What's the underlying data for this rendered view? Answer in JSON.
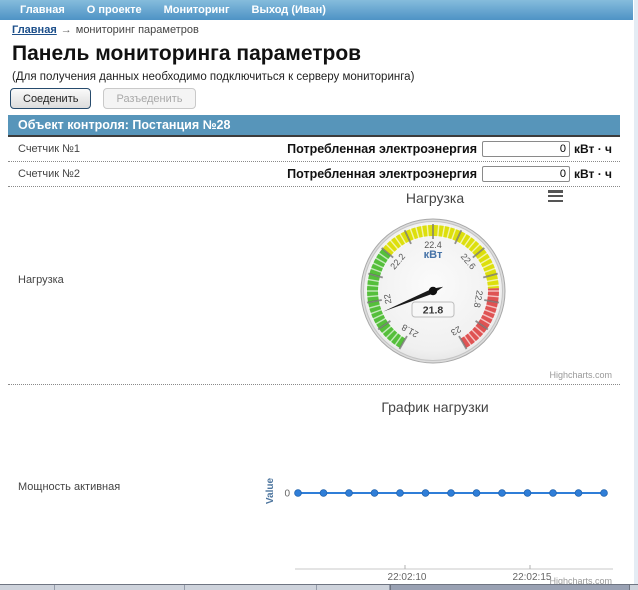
{
  "nav": {
    "items": [
      {
        "label": "Главная"
      },
      {
        "label": "О проекте"
      },
      {
        "label": "Мониторинг"
      },
      {
        "label": "Выход (Иван)"
      }
    ]
  },
  "breadcrumb": {
    "home": "Главная",
    "separator": "→",
    "current": "мониторинг параметров"
  },
  "page": {
    "title": "Панель мониторинга параметров",
    "subtitle": "(Для получения данных необходимо подключиться к серверу мониторинга)",
    "connect_label": "Соеденить",
    "disconnect_label": "Разъеденить"
  },
  "panel": {
    "header": "Объект контроля: Постанция №28",
    "counters": [
      {
        "label": "Счетчик №1",
        "field": "Потребленная электроэнергия",
        "value": "0",
        "unit": "кВт · ч"
      },
      {
        "label": "Счетчик №2",
        "field": "Потребленная электроэнергия",
        "value": "0",
        "unit": "кВт · ч"
      }
    ],
    "gauge_row_label": "Нагрузка",
    "line_row_label": "Мощность активная"
  },
  "colors": {
    "nav_top": "#85bcdc",
    "nav_bottom": "#4e93c5",
    "panel_header": "#5795ba",
    "band_green": "#55BF3B",
    "band_yellow": "#DDDF0D",
    "band_red": "#DF5353",
    "series_blue": "#2f7ed8"
  },
  "chart_data": [
    {
      "type": "gauge",
      "title": "Нагрузка",
      "unit": "кВт",
      "value": "21.8",
      "needle_value": 21.95,
      "min": 21.8,
      "max": 23,
      "start_angle": -150,
      "end_angle": 150,
      "tick_labels": [
        "21.8",
        "22",
        "22.2",
        "22.4",
        "22.6",
        "22.8",
        "23"
      ],
      "bands": [
        {
          "from": 21.8,
          "to": 22.2,
          "color": "#55BF3B"
        },
        {
          "from": 22.2,
          "to": 22.75,
          "color": "#DDDF0D"
        },
        {
          "from": 22.75,
          "to": 23,
          "color": "#DF5353"
        }
      ],
      "credit": "Highcharts.com"
    },
    {
      "type": "line",
      "title": "График нагрузки",
      "ylabel": "Value",
      "y_ticks": [
        "0"
      ],
      "x_ticks": [
        "22:02:10",
        "22:02:15"
      ],
      "legend": "none",
      "grid": "off",
      "series": [
        {
          "name": "Мощность активная",
          "color": "#2f7ed8",
          "x": [
            "22:02:06",
            "22:02:07",
            "22:02:08",
            "22:02:09",
            "22:02:10",
            "22:02:11",
            "22:02:12",
            "22:02:13",
            "22:02:14",
            "22:02:15",
            "22:02:16",
            "22:02:17",
            "22:02:18"
          ],
          "values": [
            0,
            0,
            0,
            0,
            0,
            0,
            0,
            0,
            0,
            0,
            0,
            0,
            0
          ]
        }
      ],
      "credit": "Highcharts.com"
    }
  ]
}
